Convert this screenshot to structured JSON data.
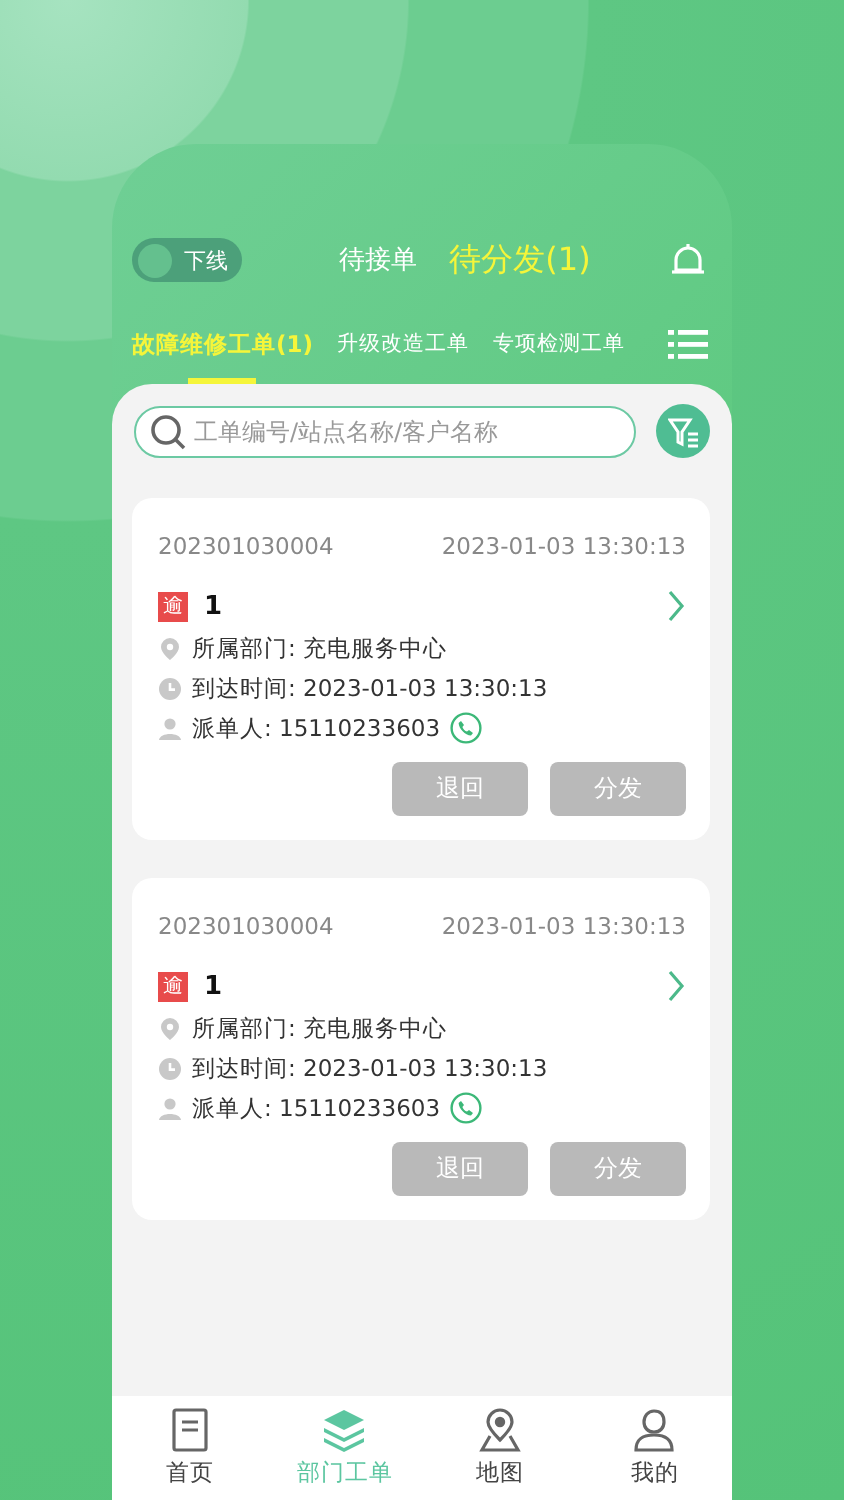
{
  "status_toggle": {
    "label": "下线",
    "on": false
  },
  "top_tabs": [
    {
      "label": "待接单",
      "selected": false
    },
    {
      "label": "待分发(1)",
      "selected": true
    }
  ],
  "category_tabs": [
    {
      "label": "故障维修工单(1)",
      "selected": true
    },
    {
      "label": "升级改造工单",
      "selected": false
    },
    {
      "label": "专项检测工单",
      "selected": false
    }
  ],
  "search": {
    "placeholder": "工单编号/站点名称/客户名称"
  },
  "orders": [
    {
      "number": "202301030004",
      "time": "2023-01-03 13:30:13",
      "badge": "逾",
      "count": "1",
      "department": "所属部门: 充电服务中心",
      "arrival": "到达时间: 2023-01-03 13:30:13",
      "dispatcher": "派单人: 15110233603",
      "buttons": [
        {
          "label": "退回",
          "disabled": true
        },
        {
          "label": "分发",
          "disabled": true
        }
      ]
    },
    {
      "number": "202301030004",
      "time": "2023-01-03 13:30:13",
      "badge": "逾",
      "count": "1",
      "department": "所属部门: 充电服务中心",
      "arrival": "到达时间: 2023-01-03 13:30:13",
      "dispatcher": "派单人: 15110233603",
      "buttons": [
        {
          "label": "退回",
          "disabled": true
        },
        {
          "label": "分发",
          "disabled": true
        }
      ]
    }
  ],
  "bottom_nav": [
    {
      "label": "首页",
      "kind": "document",
      "selected": false
    },
    {
      "label": "部门工单",
      "kind": "layers",
      "selected": true
    },
    {
      "label": "地图",
      "kind": "map",
      "selected": false
    },
    {
      "label": "我的",
      "kind": "person",
      "selected": false
    }
  ]
}
